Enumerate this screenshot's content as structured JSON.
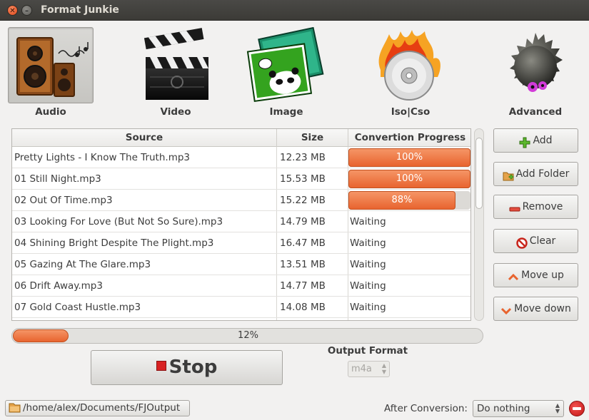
{
  "window": {
    "title": "Format Junkie"
  },
  "categories": [
    {
      "label": "Audio",
      "icon": "speakers-icon",
      "active": true
    },
    {
      "label": "Video",
      "icon": "clapperboard-icon"
    },
    {
      "label": "Image",
      "icon": "picture-icon"
    },
    {
      "label": "Iso|Cso",
      "icon": "burning-disc-icon"
    },
    {
      "label": "Advanced",
      "icon": "advanced-creature-icon"
    }
  ],
  "table": {
    "headers": {
      "source": "Source",
      "size": "Size",
      "progress": "Convertion Progress"
    },
    "rows": [
      {
        "source": "Pretty Lights - I Know The Truth.mp3",
        "size": "12.23 MB",
        "status": "100%",
        "progress": 1.0
      },
      {
        "source": "01 Still Night.mp3",
        "size": "15.53 MB",
        "status": "100%",
        "progress": 1.0
      },
      {
        "source": "02 Out Of Time.mp3",
        "size": "15.22 MB",
        "status": "88%",
        "progress": 0.88
      },
      {
        "source": "03 Looking For Love (But Not So Sure).mp3",
        "size": "14.79 MB",
        "status": "Waiting"
      },
      {
        "source": "04 Shining Bright Despite The Plight.mp3",
        "size": "16.47 MB",
        "status": "Waiting"
      },
      {
        "source": "05 Gazing At The Glare.mp3",
        "size": "13.51 MB",
        "status": "Waiting"
      },
      {
        "source": "06 Drift Away.mp3",
        "size": "14.77 MB",
        "status": "Waiting"
      },
      {
        "source": "07 Gold Coast Hustle.mp3",
        "size": "14.08 MB",
        "status": "Waiting"
      }
    ]
  },
  "actions": {
    "add": "Add",
    "add_folder": "Add Folder",
    "remove": "Remove",
    "clear": "Clear",
    "move_up": "Move up",
    "move_down": "Move down"
  },
  "overall": {
    "label": "12%",
    "progress": 0.12
  },
  "stop_label": "Stop",
  "output": {
    "label": "Output Format",
    "value": "m4a"
  },
  "output_path": "/home/alex/Documents/FJOutput",
  "after_conversion": {
    "label": "After Conversion:",
    "value": "Do nothing"
  },
  "colors": {
    "accent": "#e8642f",
    "titlebar": "#3c3b37",
    "window": "#f2f1f0"
  }
}
